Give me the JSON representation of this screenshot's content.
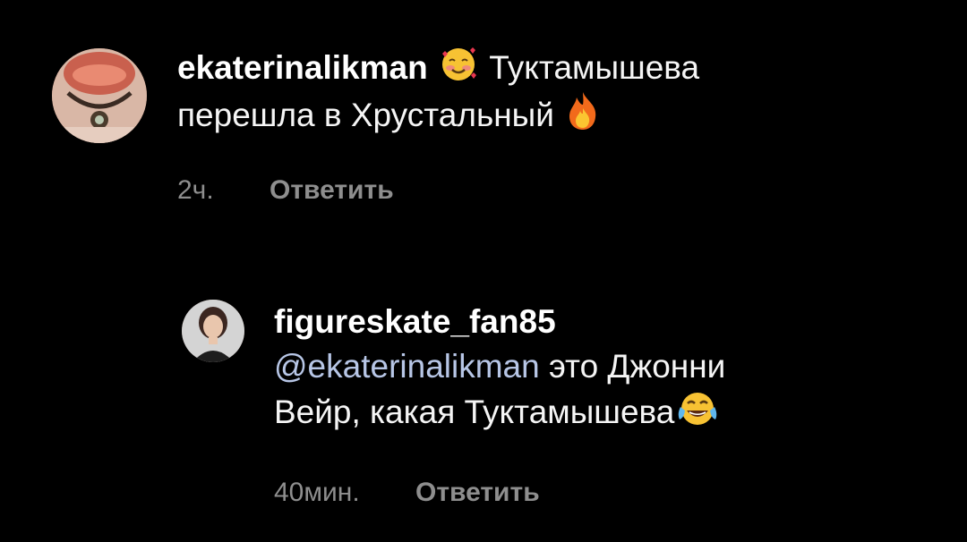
{
  "comments": [
    {
      "username": "ekaterinalikman",
      "emoji_1": "smiling-face-with-hearts",
      "text_line_1": "Туктамышева",
      "text_line_2": "перешла в Хрустальный",
      "emoji_2": "fire",
      "time": "2ч.",
      "reply_label": "Ответить"
    },
    {
      "username": "figureskate_fan85",
      "mention": "@ekaterinalikman",
      "text_part_1": "это Джонни",
      "text_part_2": "Вейр, какая Туктамышева",
      "emoji_1": "face-with-tears-of-joy",
      "time": "40мин.",
      "reply_label": "Ответить"
    }
  ],
  "colors": {
    "background": "#000000",
    "text": "#f5f5f5",
    "meta": "#8e8e8e",
    "mention": "#b7c6e6"
  }
}
